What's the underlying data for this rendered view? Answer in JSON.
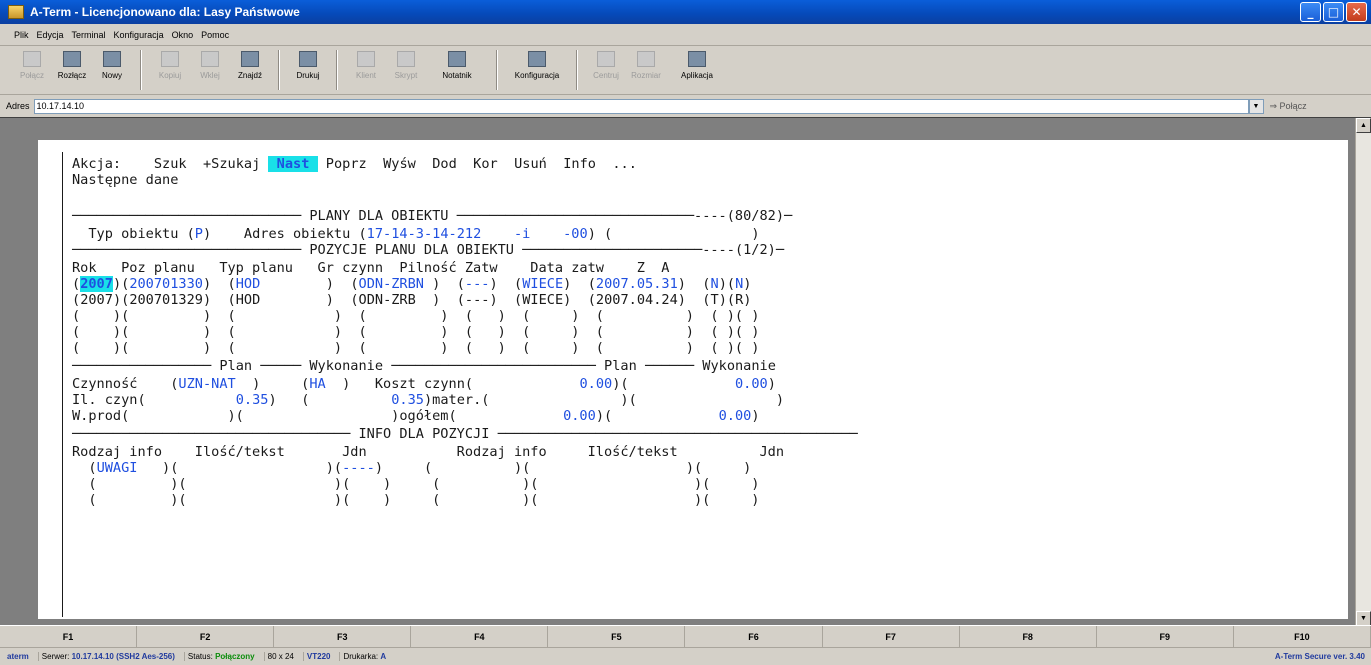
{
  "window": {
    "title": "A-Term - Licencjonowano dla: Lasy Państwowe"
  },
  "menu": [
    "Plik",
    "Edycja",
    "Terminal",
    "Konfiguracja",
    "Okno",
    "Pomoc"
  ],
  "toolbar": [
    {
      "label": "Połącz",
      "icon": "connect-icon",
      "disabled": true
    },
    {
      "label": "Rozłącz",
      "icon": "disconnect-icon",
      "disabled": false
    },
    {
      "label": "Nowy",
      "icon": "new-window-icon",
      "disabled": false
    },
    {
      "label": "Kopiuj",
      "icon": "copy-icon",
      "disabled": true
    },
    {
      "label": "Wklej",
      "icon": "paste-icon",
      "disabled": true
    },
    {
      "label": "Znajdź",
      "icon": "binoculars-icon",
      "disabled": false
    },
    {
      "label": "Drukuj",
      "icon": "printer-icon",
      "disabled": false
    },
    {
      "label": "Klient",
      "icon": "client-icon",
      "disabled": true
    },
    {
      "label": "Skrypt",
      "icon": "script-icon",
      "disabled": true
    },
    {
      "label": "Notatnik",
      "icon": "notepad-icon",
      "disabled": false
    },
    {
      "label": "Konfiguracja",
      "icon": "config-icon",
      "disabled": false
    },
    {
      "label": "Centruj",
      "icon": "center-icon",
      "disabled": true
    },
    {
      "label": "Rozmiar",
      "icon": "resize-icon",
      "disabled": true
    },
    {
      "label": "Aplikacja",
      "icon": "app-icon",
      "disabled": false
    }
  ],
  "address": {
    "label": "Adres",
    "value": "10.17.14.10",
    "connect_label": "⇒ Połącz"
  },
  "screen": {
    "akcja_label": "Akcja:",
    "actions": [
      "Szuk",
      "+Szukaj",
      "Nast",
      "Poprz",
      "Wyśw",
      "Dod",
      "Kor",
      "Usuń",
      "Info",
      "..."
    ],
    "status": "Następne dane",
    "title_plany": "PLANY DLA OBIEKTU",
    "count_plany": "(80/82)",
    "typ_label": "Typ obiektu",
    "typ_value": "P",
    "adres_label": "Adres obiektu",
    "adres_value": "17-14-3-14-212",
    "adres_suffix1": "-i",
    "adres_suffix2": "-00",
    "title_pozycje": "POZYCJE PLANU DLA OBIEKTU",
    "count_pozycje": "(1/2)",
    "headers": "Rok   Poz planu   Typ planu   Gr czynn  Pilność Zatw    Data zatw    Z  A",
    "rows": [
      {
        "rok": "2007",
        "poz": "200701330",
        "typ": "HOD",
        "gr": "ODN-ZRBN",
        "pil": "---",
        "zatw": "WIECE",
        "data": "2007.05.31",
        "z": "N",
        "a": "N"
      },
      {
        "rok": "2007",
        "poz": "200701329",
        "typ": "HOD",
        "gr": "ODN-ZRB",
        "pil": "---",
        "zatw": "WIECE",
        "data": "2007.04.24",
        "z": "T",
        "a": "R"
      }
    ],
    "plan_label": "Plan",
    "wykonanie_label": "Wykonanie",
    "czynnosc_label": "Czynność",
    "czynnosc_value": "UZN-NAT",
    "czynnosc_unit": "HA",
    "koszt_label": "Koszt czynn",
    "koszt_plan": "0.00",
    "koszt_wyk": "0.00",
    "il_label": "Il. czyn",
    "il_plan": "0.35",
    "il_wyk": "0.35",
    "mater_label": "mater.",
    "wprod_label": "W.prod",
    "ogolem_label": "ogółem",
    "ogolem_plan": "0.00",
    "ogolem_wyk": "0.00",
    "title_info": "INFO DLA POZYCJI",
    "info_headers": "Rodzaj info    Ilość/tekst       Jdn           Rodzaj info     Ilość/tekst          Jdn",
    "info_row1_rodzaj": "UWAGI",
    "info_row1_jdn": "----"
  },
  "fkeys": [
    "F1",
    "F2",
    "F3",
    "F4",
    "F5",
    "F6",
    "F7",
    "F8",
    "F9",
    "F10"
  ],
  "status": {
    "app": "aterm",
    "server_label": "Serwer:",
    "server_value": "10.17.14.10 (SSH2 Aes-256)",
    "status_label": "Status:",
    "status_value": "Połączony",
    "size": "80 x 24",
    "terminal": "VT220",
    "druk_label": "Drukarka:",
    "druk_value": "A",
    "version": "A-Term Secure ver. 3.40"
  }
}
